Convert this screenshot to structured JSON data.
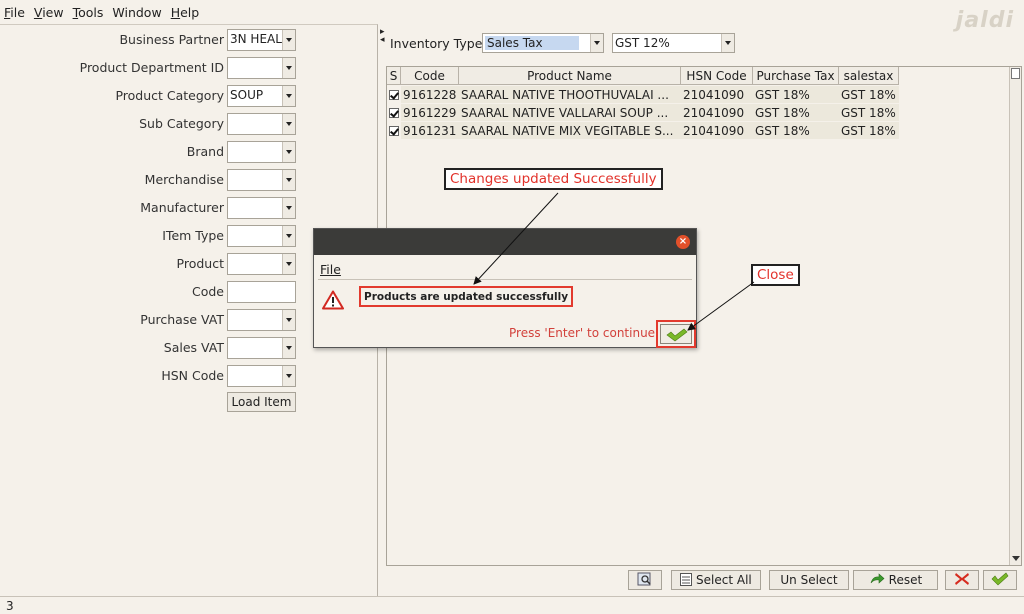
{
  "menu": [
    {
      "label": "File",
      "mnemonic": "F",
      "rest": "ile"
    },
    {
      "label": "View",
      "mnemonic": "V",
      "rest": "iew"
    },
    {
      "label": "Tools",
      "mnemonic": "T",
      "rest": "ools"
    },
    {
      "label": "Window",
      "mnemonic": "",
      "rest": "Window"
    },
    {
      "label": "Help",
      "mnemonic": "H",
      "rest": "elp"
    }
  ],
  "logo": "jaldi",
  "filters": {
    "business_partner": {
      "label": "Business Partner",
      "value": "3N HEAL"
    },
    "product_department": {
      "label": "Product Department ID",
      "value": ""
    },
    "product_category": {
      "label": "Product Category",
      "value": "SOUP"
    },
    "sub_category": {
      "label": "Sub Category",
      "value": ""
    },
    "brand": {
      "label": "Brand",
      "value": ""
    },
    "merchandise": {
      "label": "Merchandise",
      "value": ""
    },
    "manufacturer": {
      "label": "Manufacturer",
      "value": ""
    },
    "item_type": {
      "label": "ITem Type",
      "value": ""
    },
    "product": {
      "label": "Product",
      "value": ""
    },
    "code": {
      "label": "Code",
      "value": ""
    },
    "purchase_vat": {
      "label": "Purchase VAT",
      "value": ""
    },
    "sales_vat": {
      "label": "Sales VAT",
      "value": ""
    },
    "hsn_code": {
      "label": "HSN Code",
      "value": ""
    },
    "load_item_label": "Load Item"
  },
  "inventory": {
    "label": "Inventory Type",
    "type_value": "Sales Tax",
    "tax_value": "GST 12%"
  },
  "table": {
    "columns": [
      "S",
      "Code",
      "Product Name",
      "HSN Code",
      "Purchase Tax",
      "salestax"
    ],
    "rows": [
      {
        "selected": true,
        "code": "9161228",
        "name": "SAARAL NATIVE THOOTHUVALAI ...",
        "hsn": "21041090",
        "purchase_tax": "GST 18%",
        "sales_tax": "GST 18%"
      },
      {
        "selected": true,
        "code": "9161229",
        "name": "SAARAL NATIVE  VALLARAI SOUP ...",
        "hsn": "21041090",
        "purchase_tax": "GST 18%",
        "sales_tax": "GST 18%"
      },
      {
        "selected": true,
        "code": "9161231",
        "name": "SAARAL NATIVE MIX VEGITABLE S...",
        "hsn": "21041090",
        "purchase_tax": "GST 18%",
        "sales_tax": "GST 18%"
      }
    ]
  },
  "toolbar": {
    "select_all": "Select All",
    "un_select": "Un Select",
    "reset": "Reset"
  },
  "status": "3",
  "dialog": {
    "menu_file": "File",
    "message": "Products are updated successfully",
    "hint": "Press 'Enter' to continue",
    "close_glyph": "×"
  },
  "callouts": {
    "changes": "Changes updated Successfully",
    "close": "Close"
  },
  "colors": {
    "accent_red": "#e2312a",
    "ok_green": "#7ab829",
    "selection_blue": "#c6d8f0"
  }
}
